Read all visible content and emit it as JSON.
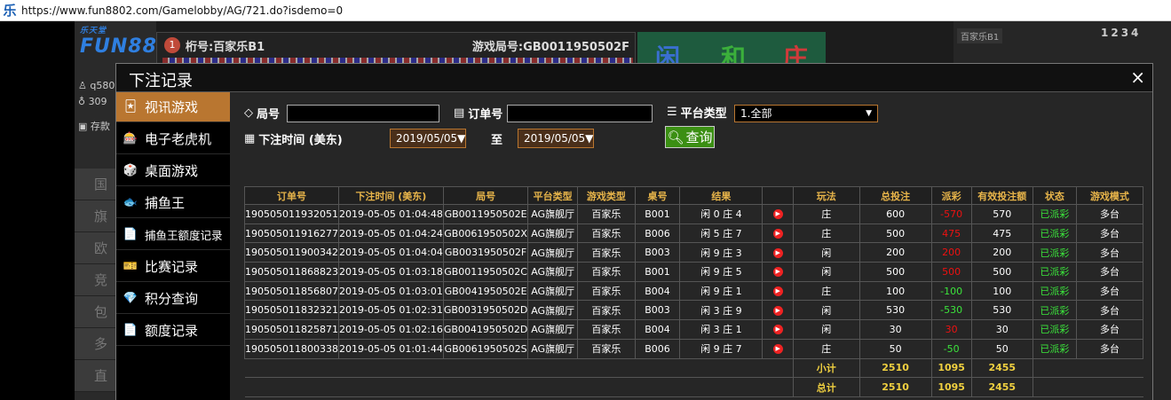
{
  "browser": {
    "favicon": "乐",
    "url": "https://www.fun8802.com/Gamelobby/AG/721.do?isdemo=0"
  },
  "lobby": {
    "logo_small": "乐天堂",
    "logo": "FUN88",
    "user": "q580",
    "balance": "309",
    "deposit": "存款",
    "table_no": "1",
    "table_name": "桁号:百家乐B1",
    "round": "游戏局号:GB0011950502F",
    "zone_player": "闲",
    "zone_tie": "和",
    "zone_banker": "庄",
    "room_tag": "百家乐B1",
    "digits": "1234",
    "categories": [
      "国",
      "旗",
      "欧",
      "竞",
      "包",
      "多",
      "直"
    ]
  },
  "modal": {
    "title": "下注记录",
    "close": "×",
    "menu": [
      {
        "label": "视讯游戏",
        "icon": "cards-icon",
        "glyph": "🃏",
        "active": true
      },
      {
        "label": "电子老虎机",
        "icon": "slot-icon",
        "glyph": "🎰",
        "active": false
      },
      {
        "label": "桌面游戏",
        "icon": "dice-icon",
        "glyph": "🎲",
        "active": false
      },
      {
        "label": "捕鱼王",
        "icon": "fish-icon",
        "glyph": "🐟",
        "active": false
      },
      {
        "label": "捕鱼王额度记录",
        "icon": "document-icon",
        "glyph": "📄",
        "active": false
      },
      {
        "label": "比赛记录",
        "icon": "ticket-icon",
        "glyph": "🎫",
        "active": false
      },
      {
        "label": "积分查询",
        "icon": "diamond-icon",
        "glyph": "💎",
        "active": false
      },
      {
        "label": "额度记录",
        "icon": "document-icon",
        "glyph": "📄",
        "active": false
      }
    ],
    "filters": {
      "round_label": "局号",
      "round_value": "",
      "order_label": "订单号",
      "order_value": "",
      "platform_label": "平台类型",
      "platform_value": "1.全部",
      "time_label": "下注时间 (美东)",
      "date_from": "2019/05/05",
      "to_label": "至",
      "date_to": "2019/05/05",
      "query_label": "查询"
    },
    "table": {
      "headers": [
        "订单号",
        "下注时间 (美东)",
        "局号",
        "平台类型",
        "游戏类型",
        "桌号",
        "结果",
        "",
        "玩法",
        "总投注",
        "派彩",
        "有效投注额",
        "状态",
        "游戏模式"
      ],
      "rows": [
        {
          "order": "190505011932051",
          "time": "2019-05-05 01:04:48",
          "round": "GB0011950502E",
          "platform": "AG旗舰厅",
          "game": "百家乐",
          "table": "B001",
          "result": "闲 0 庄 4",
          "play": "庄",
          "bet": "600",
          "payout": "-570",
          "payout_color": "red",
          "valid": "570",
          "status": "已派彩",
          "mode": "多台"
        },
        {
          "order": "190505011916277",
          "time": "2019-05-05 01:04:24",
          "round": "GB0061950502X",
          "platform": "AG旗舰厅",
          "game": "百家乐",
          "table": "B006",
          "result": "闲 5 庄 7",
          "play": "庄",
          "bet": "500",
          "payout": "475",
          "payout_color": "red",
          "valid": "475",
          "status": "已派彩",
          "mode": "多台"
        },
        {
          "order": "190505011900342",
          "time": "2019-05-05 01:04:04",
          "round": "GB0031950502F",
          "platform": "AG旗舰厅",
          "game": "百家乐",
          "table": "B003",
          "result": "闲 9 庄 3",
          "play": "闲",
          "bet": "200",
          "payout": "200",
          "payout_color": "red",
          "valid": "200",
          "status": "已派彩",
          "mode": "多台"
        },
        {
          "order": "190505011868823",
          "time": "2019-05-05 01:03:18",
          "round": "GB0011950502C",
          "platform": "AG旗舰厅",
          "game": "百家乐",
          "table": "B001",
          "result": "闲 9 庄 5",
          "play": "闲",
          "bet": "500",
          "payout": "500",
          "payout_color": "red",
          "valid": "500",
          "status": "已派彩",
          "mode": "多台"
        },
        {
          "order": "190505011856807",
          "time": "2019-05-05 01:03:01",
          "round": "GB0041950502E",
          "platform": "AG旗舰厅",
          "game": "百家乐",
          "table": "B004",
          "result": "闲 9 庄 1",
          "play": "庄",
          "bet": "100",
          "payout": "-100",
          "payout_color": "green",
          "valid": "100",
          "status": "已派彩",
          "mode": "多台"
        },
        {
          "order": "190505011832321",
          "time": "2019-05-05 01:02:31",
          "round": "GB0031950502D",
          "platform": "AG旗舰厅",
          "game": "百家乐",
          "table": "B003",
          "result": "闲 3 庄 9",
          "play": "闲",
          "bet": "530",
          "payout": "-530",
          "payout_color": "green",
          "valid": "530",
          "status": "已派彩",
          "mode": "多台"
        },
        {
          "order": "190505011825871",
          "time": "2019-05-05 01:02:16",
          "round": "GB0041950502D",
          "platform": "AG旗舰厅",
          "game": "百家乐",
          "table": "B004",
          "result": "闲 3 庄 1",
          "play": "闲",
          "bet": "30",
          "payout": "30",
          "payout_color": "red",
          "valid": "30",
          "status": "已派彩",
          "mode": "多台"
        },
        {
          "order": "190505011800338",
          "time": "2019-05-05 01:01:44",
          "round": "GB0061950502S",
          "platform": "AG旗舰厅",
          "game": "百家乐",
          "table": "B006",
          "result": "闲 9 庄 7",
          "play": "庄",
          "bet": "50",
          "payout": "-50",
          "payout_color": "green",
          "valid": "50",
          "status": "已派彩",
          "mode": "多台"
        }
      ],
      "subtotal": {
        "label": "小计",
        "bet": "2510",
        "payout": "1095",
        "valid": "2455"
      },
      "total": {
        "label": "总计",
        "bet": "2510",
        "payout": "1095",
        "valid": "2455"
      }
    }
  },
  "colors": {
    "accent": "#b97630",
    "header_gold": "#e7b44a",
    "win_red": "#e11111",
    "loss_green": "#3be43b",
    "query_green": "#3b8f13"
  }
}
